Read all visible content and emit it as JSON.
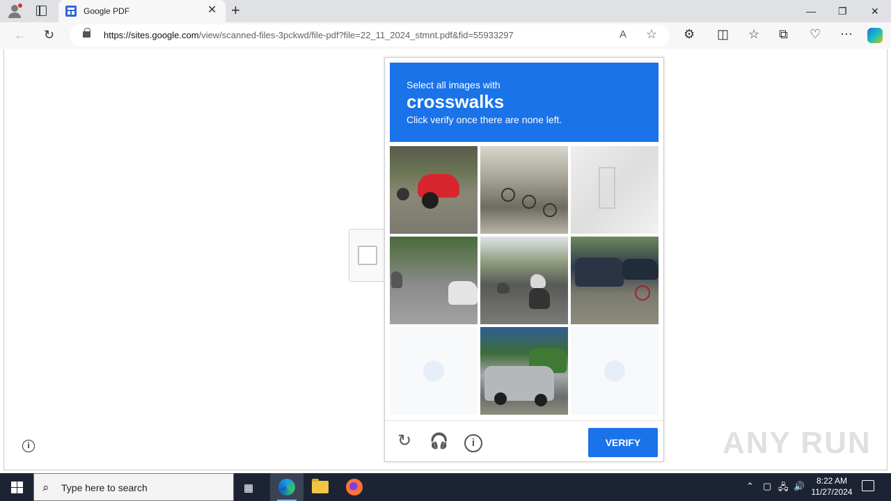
{
  "browser": {
    "tab_title": "Google PDF",
    "tab_close": "✕",
    "new_tab": "+",
    "url_host": "https://sites.google.com",
    "url_path": "/view/scanned-files-3pckwd/file-pdf?file=22_11_2024_stmnt.pdf&fid=55933297",
    "window_controls": {
      "minimize": "—",
      "restore": "❐",
      "close": "✕"
    },
    "icons": {
      "back": "←",
      "refresh": "↻",
      "read_aloud": "A",
      "favorite": "☆",
      "extensions": "⚙",
      "split": "◫",
      "favorites": "☆",
      "collections": "⧉",
      "browser_essentials": "♡",
      "more": "⋯"
    }
  },
  "captcha": {
    "instruction": "Select all images with",
    "target": "crosswalks",
    "hint": "Click verify once there are none left.",
    "verify_label": "VERIFY",
    "reload_icon": "↻",
    "audio_icon": "🎧",
    "info_icon": "i",
    "tiles": [
      "scooter-sidewalk",
      "parked-bicycles",
      "white-wall",
      "street-traffic-cars",
      "road-traffic",
      "cars-cyclist",
      "blank",
      "silver-suv-truck",
      "blank"
    ]
  },
  "page": {
    "info_icon": "i",
    "watermark": "ANY RUN"
  },
  "taskbar": {
    "search_placeholder": "Type here to search",
    "search_icon": "⌕",
    "time": "8:22 AM",
    "date": "11/27/2024",
    "tray_icons": {
      "chevron": "⌃",
      "network": "🖧",
      "volume": "🔊",
      "meet": "▢"
    }
  },
  "colors": {
    "accent": "#1a73e8",
    "taskbar": "#1c2433",
    "tabbar": "#dfe1e5"
  }
}
